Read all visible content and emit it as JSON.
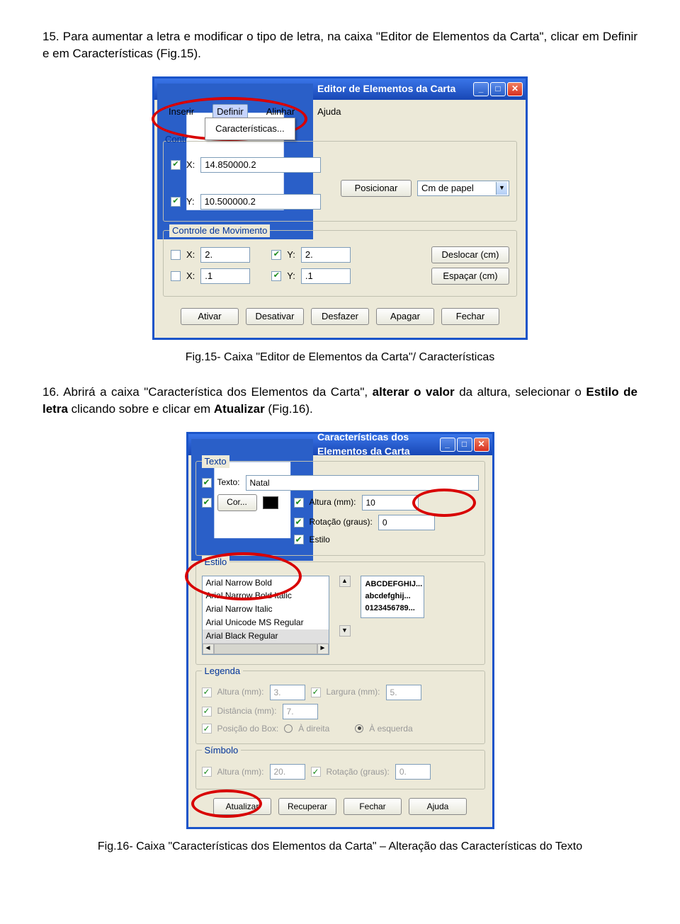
{
  "para15": "15. Para aumentar a letra e modificar o tipo de letra, na caixa \"Editor de Elementos da Carta\", clicar em Definir e em Características (Fig.15).",
  "para16a": "16. Abrirá a caixa \"Característica dos Elementos da Carta\", ",
  "para16b": "alterar o valor",
  "para16c": " da altura, selecionar o ",
  "para16d": "Estilo de letra",
  "para16e": " clicando sobre e clicar em ",
  "para16f": "Atualizar",
  "para16g": " (Fig.16).",
  "cap15": "Fig.15- Caixa \"Editor de Elementos da Carta\"/ Características",
  "cap16": "Fig.16- Caixa \"Características dos Elementos da Carta\" – Alteração das Características do Texto",
  "win1": {
    "title": "Editor de Elementos da Carta",
    "menu": {
      "inserir": "Inserir",
      "definir": "Definir",
      "alinhar": "Alinhar",
      "ajuda": "Ajuda",
      "carac": "Características..."
    },
    "contr": "Contr",
    "x": "X:",
    "y": "Y:",
    "xval": "14.850000.2",
    "yval": "10.500000.2",
    "posicionar": "Posicionar",
    "unit": "Cm de papel",
    "group2": "Controle de Movimento",
    "x2": "2.",
    "y2": "2.",
    "x3": ".1",
    "y3": ".1",
    "deslocar": "Deslocar (cm)",
    "espacar": "Espaçar (cm)",
    "ativar": "Ativar",
    "desativar": "Desativar",
    "desfazer": "Desfazer",
    "apagar": "Apagar",
    "fechar": "Fechar"
  },
  "win2": {
    "title": "Características dos Elementos da Carta",
    "gTexto": "Texto",
    "texto": "Texto:",
    "textoval": "Natal",
    "cor": "Cor...",
    "altura": "Altura (mm):",
    "alturaval": "10",
    "rotacao": "Rotação (graus):",
    "rotacaoval": "0",
    "estilo": "Estilo",
    "gEstilo": "Estilo",
    "fonts": [
      "Arial Narrow Bold",
      "Arial Narrow Bold Italic",
      "Arial Narrow Italic",
      "Arial Unicode MS Regular",
      "Arial Black Regular"
    ],
    "prev1": "ABCDEFGHIJ...",
    "prev2": "abcdefghij...",
    "prev3": "0123456789...",
    "gLegenda": "Legenda",
    "legAlt": "Altura (mm):",
    "legAltV": "3.",
    "legLarg": "Largura (mm):",
    "legLargV": "5.",
    "legDist": "Distância (mm):",
    "legDistV": "7.",
    "posbox": "Posição do Box:",
    "dir": "À direita",
    "esq": "À esquerda",
    "gSimbolo": "Símbolo",
    "simAlt": "Altura (mm):",
    "simAltV": "20.",
    "simRot": "Rotação (graus):",
    "simRotV": "0.",
    "atualizar": "Atualizar",
    "recuperar": "Recuperar",
    "fechar": "Fechar",
    "ajuda": "Ajuda"
  }
}
